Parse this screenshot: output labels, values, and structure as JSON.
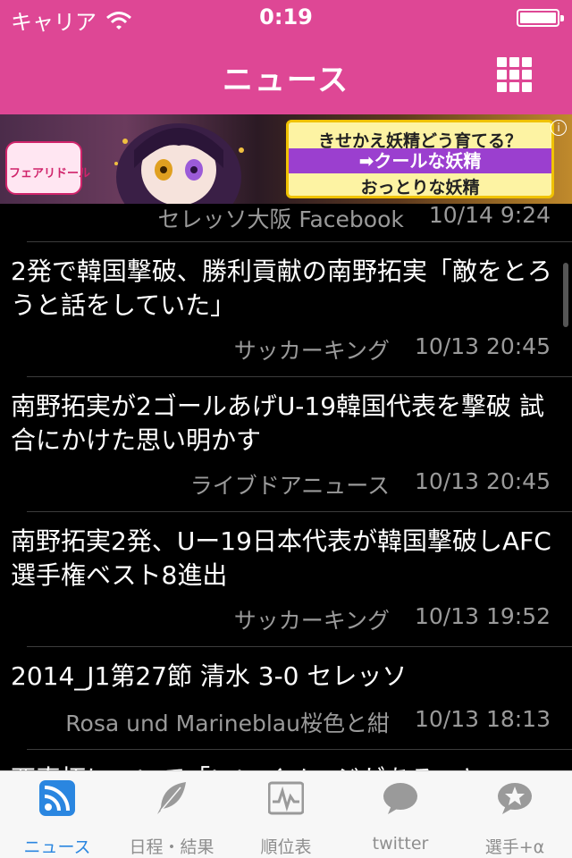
{
  "status": {
    "carrier": "キャリア",
    "time": "0:19"
  },
  "nav": {
    "title": "ニュース",
    "menu_icon": "grid-icon"
  },
  "ad": {
    "line1": "きせかえ妖精どう育てる？",
    "line2": "➡クールな妖精",
    "line3": "おっとりな妖精",
    "logo": "フェアリドール",
    "info": "i"
  },
  "news": [
    {
      "title": "",
      "source": "セレッソ大阪 Facebook",
      "date": "10/14 9:24"
    },
    {
      "title": "2発で韓国撃破、勝利貢献の南野拓実「敵をとろうと話をしていた」",
      "source": "サッカーキング",
      "date": "10/13 20:45"
    },
    {
      "title": "南野拓実が2ゴールあげU-19韓国代表を撃破 試合にかけた思い明かす",
      "source": "ライブドアニュース",
      "date": "10/13 20:45"
    },
    {
      "title": "南野拓実2発、Uー19日本代表が韓国撃破しAFC選手権ベスト8進出",
      "source": "サッカーキング",
      "date": "10/13 19:52"
    },
    {
      "title": "2014_J1第27節 清水 3-0 セレッソ",
      "source": "Rosa und Marineblau桜色と紺",
      "date": "10/13 18:13"
    },
    {
      "title": "西真拓について「いいイメージがある」と",
      "source": "",
      "date": ""
    }
  ],
  "tabs": [
    {
      "label": "ニュース",
      "icon": "rss-icon",
      "active": true
    },
    {
      "label": "日程・結果",
      "icon": "feather-icon",
      "active": false
    },
    {
      "label": "順位表",
      "icon": "chart-icon",
      "active": false
    },
    {
      "label": "twitter",
      "icon": "speech-bubble-icon",
      "active": false
    },
    {
      "label": "選手+α",
      "icon": "star-bubble-icon",
      "active": false
    }
  ],
  "colors": {
    "brand": "#de4795",
    "tab_active": "#2a86e0"
  }
}
